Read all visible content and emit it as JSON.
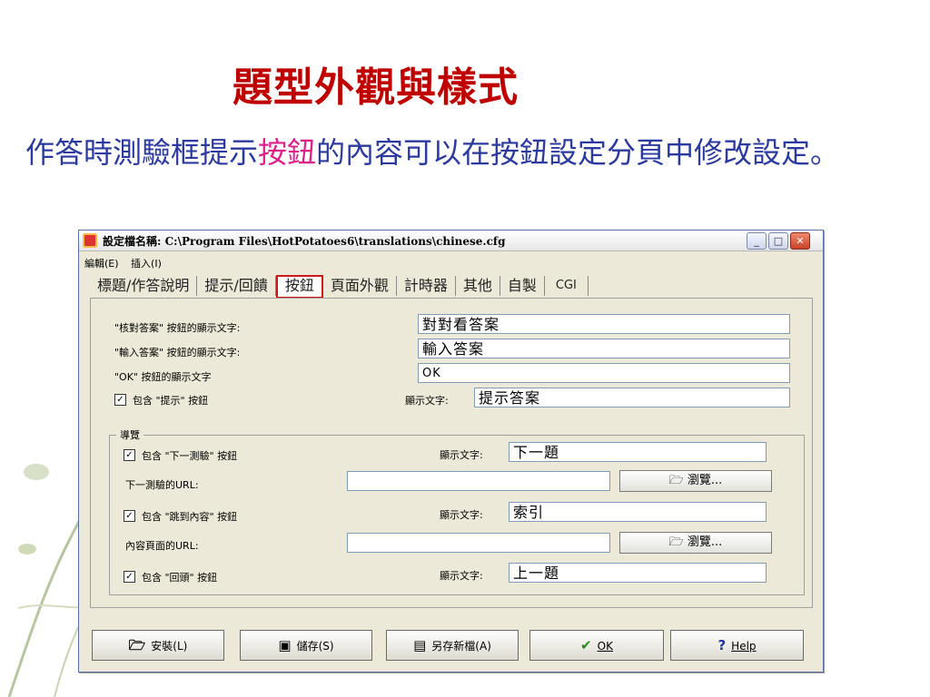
{
  "slide": {
    "title": "題型外觀與樣式",
    "text_before": "作答時測驗框提示",
    "text_highlight": "按鈕",
    "text_after": "的內容可以在按鈕設定分頁中修改設定。"
  },
  "window": {
    "title": "設定檔名稱: C:\\Program Files\\HotPotatoes6\\translations\\chinese.cfg",
    "controls": {
      "minimize": "_",
      "maximize": "□",
      "close": "✕"
    }
  },
  "menu": {
    "edit": "編輯(E)",
    "insert": "插入(I)"
  },
  "tabs": [
    "標題/作答說明",
    "提示/回饋",
    "按鈕",
    "頁面外觀",
    "計時器",
    "其他",
    "自製",
    "CGI"
  ],
  "active_tab": "按鈕",
  "buttons_tab": {
    "check_label": "\"核對答案\" 按鈕的顯示文字:",
    "check_value": "對對看答案",
    "enter_label": "\"輸入答案\" 按鈕的顯示文字:",
    "enter_value": "輸入答案",
    "ok_label": "\"OK\" 按鈕的顯示文字",
    "ok_value": "OK",
    "hint_checkbox": "包含 \"提示\" 按鈕",
    "hint_caption_label": "顯示文字:",
    "hint_caption_value": "提示答案"
  },
  "navigation": {
    "legend": "導覽",
    "next_checkbox": "包含 \"下一測驗\" 按鈕",
    "next_caption_label": "顯示文字:",
    "next_caption_value": "下一題",
    "next_url_label": "下一測驗的URL:",
    "next_url_value": "",
    "browse_label": "瀏覽...",
    "contents_checkbox": "包含 \"跳到內容\" 按鈕",
    "contents_caption_label": "顯示文字:",
    "contents_caption_value": "索引",
    "contents_url_label": "內容頁面的URL:",
    "contents_url_value": "",
    "back_checkbox": "包含 \"回頭\" 按鈕",
    "back_caption_label": "顯示文字:",
    "back_caption_value": "上一題"
  },
  "footer": {
    "load": "安裝(L)",
    "save": "儲存(S)",
    "save_as": "另存新檔(A)",
    "ok": "OK",
    "help": "Help"
  },
  "colors": {
    "title": "#c00000",
    "body_text": "#2a3aa0",
    "highlight": "#e0208a",
    "active_tab_border": "#d01818",
    "ok_check": "#2a8a1a",
    "help_icon": "#1a3aa0"
  },
  "icons": {
    "app": "app-icon",
    "folder": "folder-icon",
    "save": "floppy-icon",
    "save_as": "save-as-icon",
    "ok": "checkmark-icon",
    "help": "question-icon"
  }
}
